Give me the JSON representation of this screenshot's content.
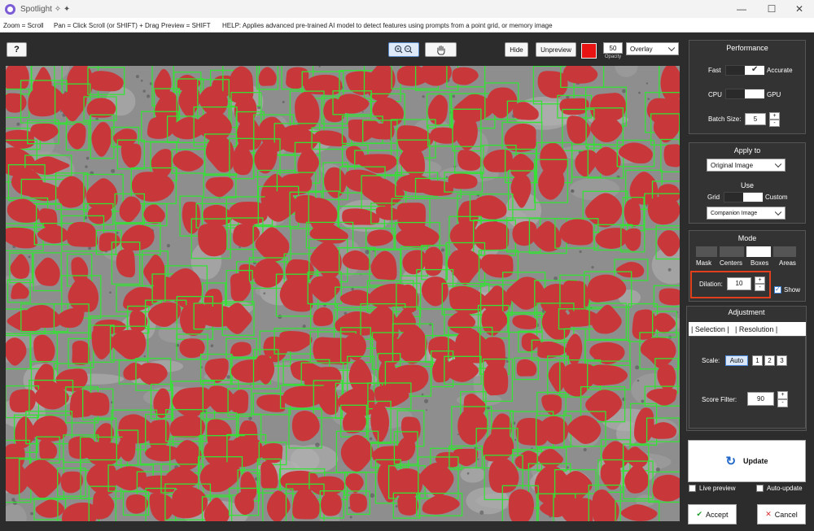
{
  "window": {
    "title": "Spotlight ✧ ✦"
  },
  "helpbar": {
    "zoom": "Zoom = Scroll",
    "pan": "Pan = Click Scroll (or SHIFT) + Drag",
    "preview": "Preview = SHIFT",
    "help": "HELP:  Applies advanced pre-trained AI model to detect features using prompts from a point grid, or memory image"
  },
  "toolbar": {
    "help_label": "?",
    "hide_label": "Hide",
    "unpreview_label": "Unpreview",
    "overlay_color": "#e81414",
    "opacity_value": "50",
    "opacity_label": "Opacity",
    "overlay_mode": "Overlay"
  },
  "performance": {
    "title": "Performance",
    "fast_label": "Fast",
    "accurate_label": "Accurate",
    "accurate_selected": true,
    "cpu_label": "CPU",
    "gpu_label": "GPU",
    "gpu_selected": true,
    "batch_label": "Batch Size:",
    "batch_value": "5"
  },
  "apply_to": {
    "title": "Apply to",
    "selected": "Original Image",
    "use_title": "Use",
    "grid_label": "Grid",
    "custom_label": "Custom",
    "custom_selected": true,
    "companion_select": "Companion Image"
  },
  "mode": {
    "title": "Mode",
    "options": [
      "Mask",
      "Centers",
      "Boxes",
      "Areas"
    ],
    "selected": "Boxes",
    "dilation_label": "Dilation:",
    "dilation_value": "10",
    "show_label": "Show",
    "show_checked": true
  },
  "adjustment": {
    "title": "Adjustment",
    "tab_selection": "| Selection |",
    "tab_resolution": "| Resolution |",
    "scale_label": "Scale:",
    "scale_options": [
      "Auto",
      "1",
      "2",
      "3"
    ],
    "scale_selected": "Auto",
    "score_label": "Score Filter:",
    "score_value": "90"
  },
  "actions": {
    "update_label": "Update",
    "live_preview_label": "Live preview",
    "auto_update_label": "Auto-update",
    "accept_label": "Accept",
    "cancel_label": "Cancel"
  },
  "colors": {
    "mask": "#c8383a",
    "box": "#35e135",
    "highlight": "#e0401b"
  }
}
